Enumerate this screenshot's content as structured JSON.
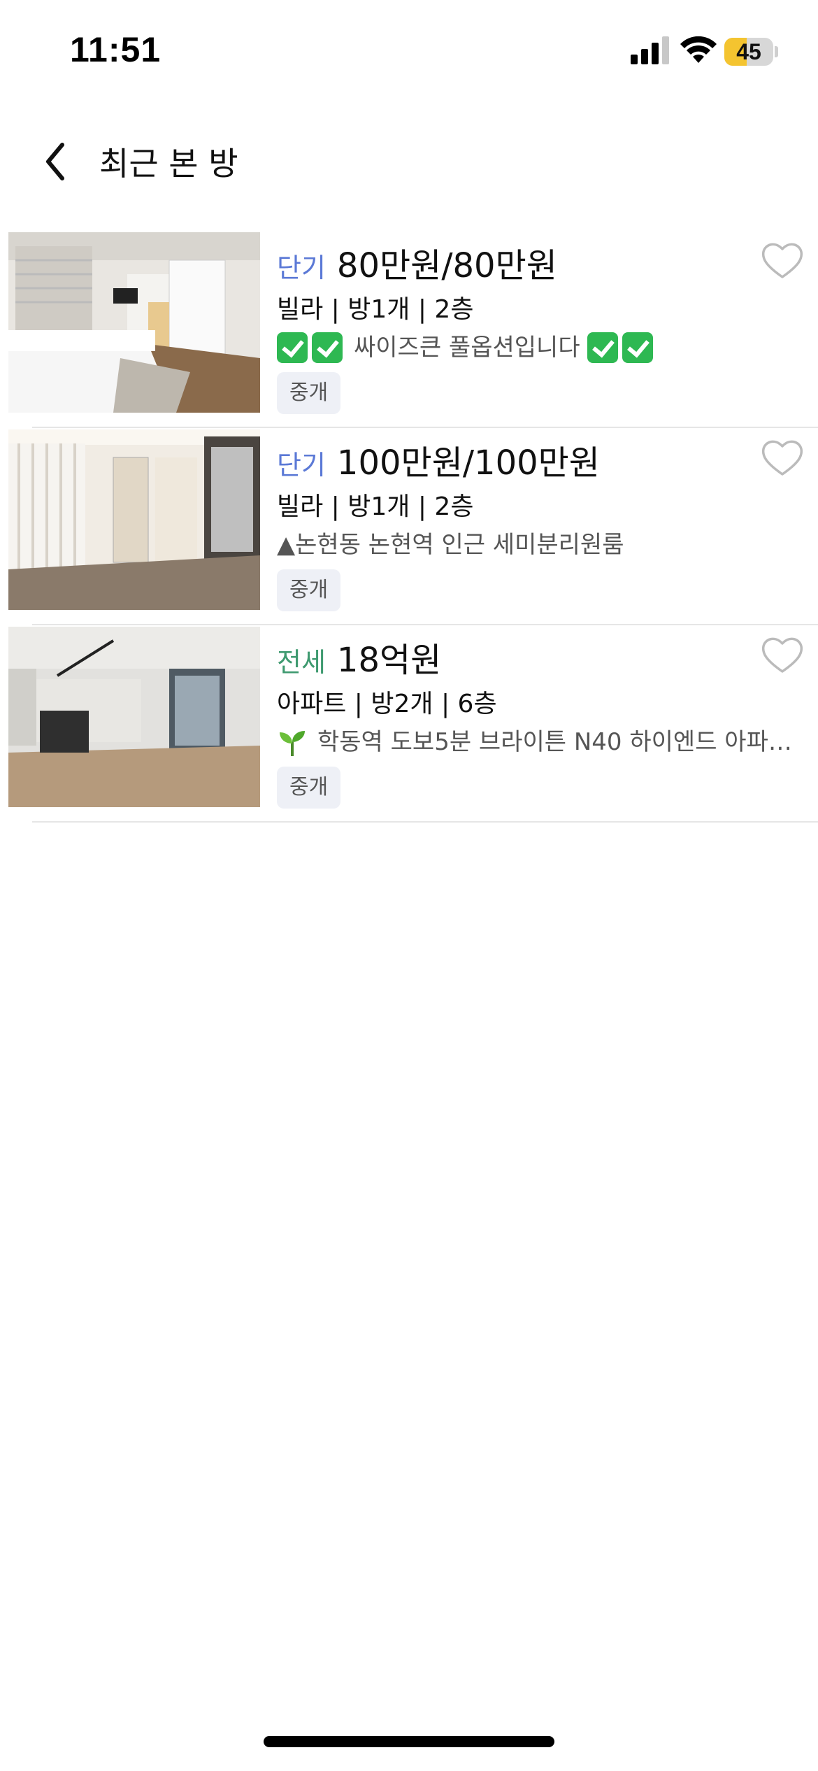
{
  "status_bar": {
    "time": "11:51",
    "battery_level": 45,
    "battery_text": "45",
    "battery_color": "#f4c430",
    "signal_bars": 3
  },
  "header": {
    "back_icon": "chevron-left-icon",
    "title": "최근 본 방"
  },
  "listings": [
    {
      "deal_type": "단기",
      "price": "80만원/80만원",
      "meta": "빌라 | 방1개 | 2층",
      "desc_prefix_icons": [
        "check-box-icon",
        "check-box-icon"
      ],
      "desc": "싸이즈큰 풀옵션입니다",
      "desc_suffix_icons": [
        "check-box-icon",
        "check-box-icon"
      ],
      "badge": "중개",
      "favorite": false
    },
    {
      "deal_type": "단기",
      "price": "100만원/100만원",
      "meta": "빌라 | 방1개 | 2층",
      "desc": "▲논현동 논현역 인근 세미분리원룸",
      "badge": "중개",
      "favorite": false
    },
    {
      "deal_type": "전세",
      "price": "18억원",
      "meta": "아파트 | 방2개 | 6층",
      "desc_prefix_icons": [
        "sprout-icon"
      ],
      "desc": "학동역 도보5분 브라이튼 N40 하이엔드 아파…",
      "badge": "중개",
      "favorite": false
    }
  ],
  "colors": {
    "short_term": "#5b79d6",
    "jeonse": "#3f9a70",
    "badge_bg": "#eef0f6"
  }
}
